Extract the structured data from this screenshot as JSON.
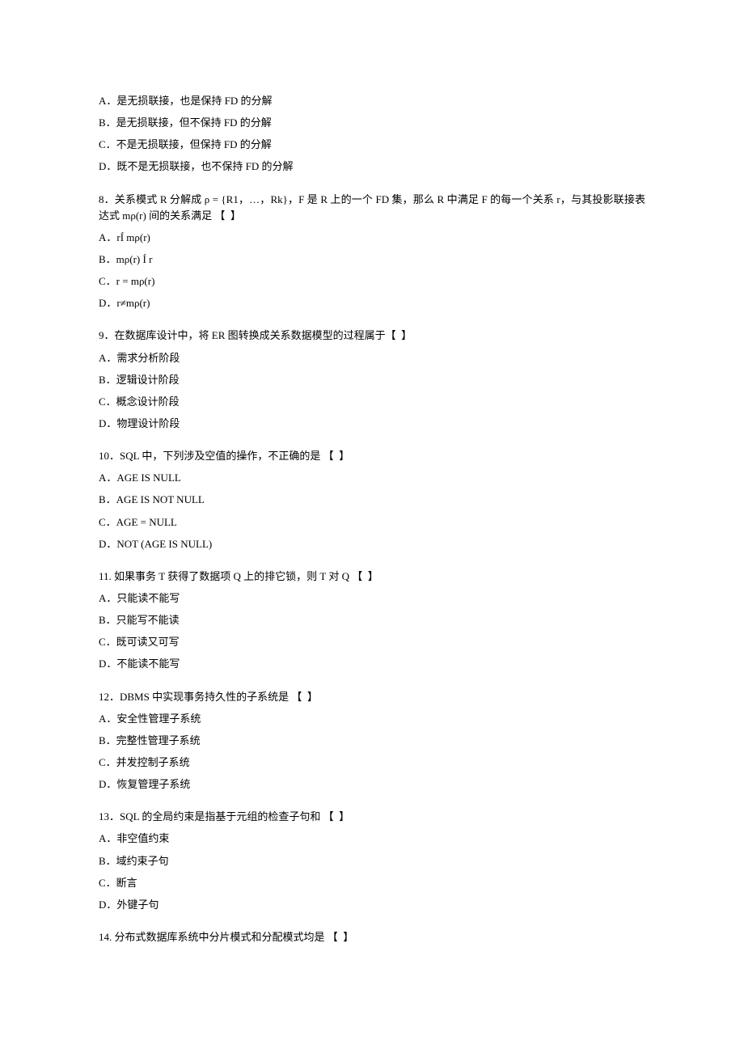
{
  "preOptions": [
    "A．是无损联接，也是保持 FD 的分解",
    "B．是无损联接，但不保持 FD 的分解",
    "C．不是无损联接，但保持 FD 的分解",
    "D．既不是无损联接，也不保持 FD 的分解"
  ],
  "questions": [
    {
      "stemLines": [
        "8．关系模式 R 分解成 ρ = {R1，…，Rk}，F 是 R 上的一个 FD 集，那么 R 中满足 F 的每一个关系 r，与其投影联接表达式 mρ(r) 间的关系满足 【  】"
      ],
      "options": [
        "A．rÍ mρ(r)",
        "B．mρ(r) Í r",
        "C．r = mρ(r)",
        "D．r≠mρ(r)"
      ]
    },
    {
      "stemLines": [
        "9．在数据库设计中，将 ER 图转换成关系数据模型的过程属于【  】"
      ],
      "options": [
        "A．需求分析阶段",
        "B．逻辑设计阶段",
        "C．概念设计阶段",
        "D．物理设计阶段"
      ]
    },
    {
      "stemLines": [
        "10．SQL 中，下列涉及空值的操作，不正确的是 【  】"
      ],
      "options": [
        "A．AGE IS NULL",
        "B．AGE IS NOT NULL",
        "C．AGE = NULL",
        "D．NOT (AGE IS NULL)"
      ]
    },
    {
      "stemLines": [
        "11. 如果事务 T 获得了数据项 Q 上的排它锁，则 T 对 Q 【  】"
      ],
      "options": [
        "A．只能读不能写",
        "B．只能写不能读",
        "C．既可读又可写",
        "D．不能读不能写"
      ]
    },
    {
      "stemLines": [
        "12．DBMS 中实现事务持久性的子系统是 【  】"
      ],
      "options": [
        "A．安全性管理子系统",
        "B．完整性管理子系统",
        "C．并发控制子系统",
        "D．恢复管理子系统"
      ]
    },
    {
      "stemLines": [
        "13．SQL 的全局约束是指基于元组的检查子句和 【  】"
      ],
      "options": [
        "A．非空值约束",
        "B．域约束子句",
        "C．断言",
        "D．外键子句"
      ]
    },
    {
      "stemLines": [
        "14. 分布式数据库系统中分片模式和分配模式均是 【  】"
      ],
      "options": []
    }
  ]
}
